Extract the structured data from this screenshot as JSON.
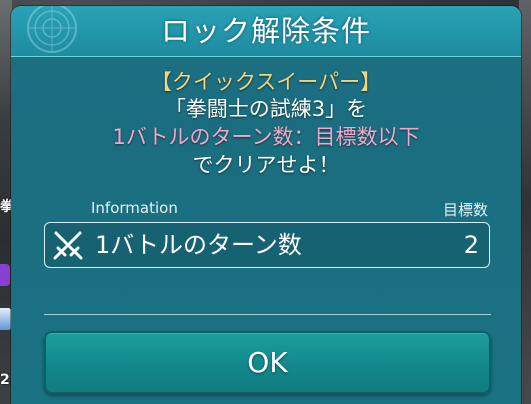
{
  "background": {
    "left_char": "拳",
    "left_char_2": "2"
  },
  "dialog": {
    "title": "ロック解除条件",
    "message": {
      "line1": "【クイックスイーパー】",
      "line2": "「拳闘士の試練3」を",
      "line3": "1バトルのターン数：目標数以下",
      "line4": "でクリアせよ！"
    },
    "info": {
      "label": "Information",
      "goal_header": "目標数",
      "condition_text": "1バトルのターン数",
      "condition_value": "2",
      "icon": "crossed-swords-icon"
    },
    "ok_label": "OK"
  },
  "colors": {
    "dialog_bg": "#1a6e80",
    "header_bg": "#2aa2b6",
    "gold_text": "#f4d57f",
    "pink_text": "#f3a7c9",
    "button_bg": "#13888c"
  }
}
